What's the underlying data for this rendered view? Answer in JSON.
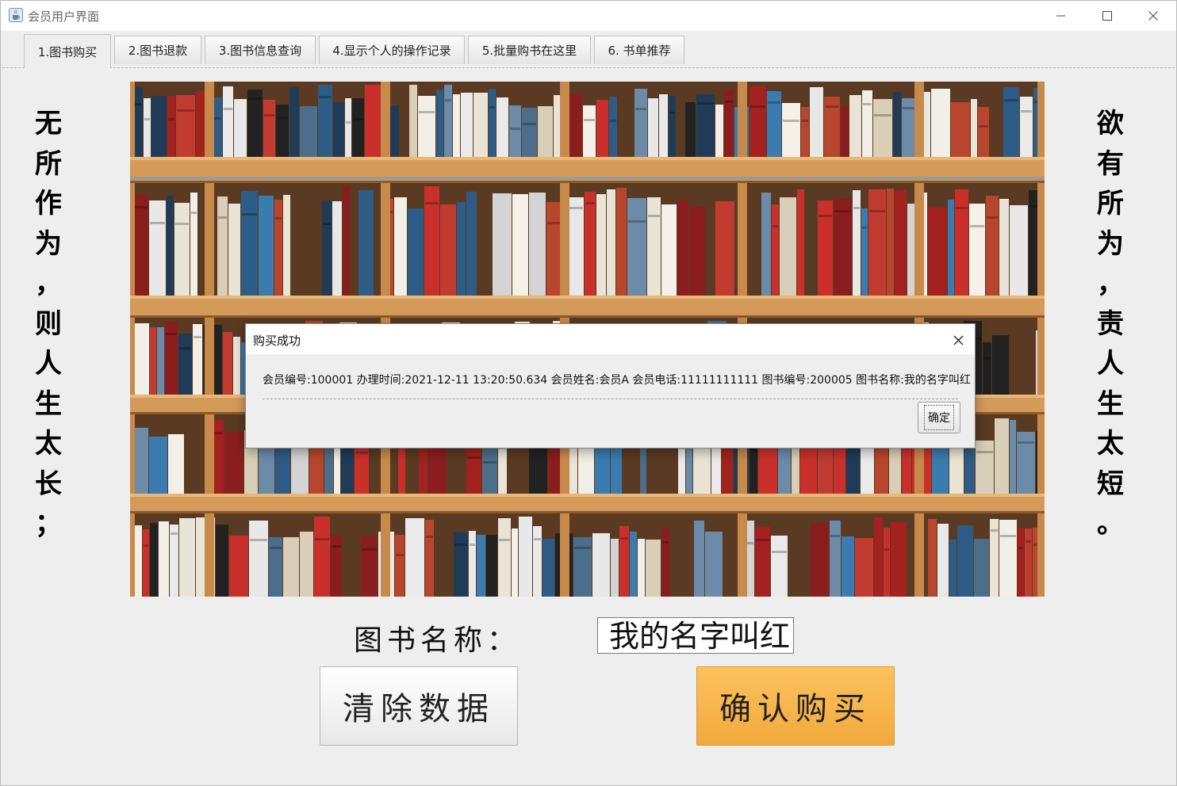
{
  "window": {
    "title": "会员用户界面"
  },
  "tabs": [
    {
      "label": "1.图书购买",
      "active": true
    },
    {
      "label": "2.图书退款",
      "active": false
    },
    {
      "label": "3.图书信息查询",
      "active": false
    },
    {
      "label": "4.显示个人的操作记录",
      "active": false
    },
    {
      "label": "5.批量购书在这里",
      "active": false
    },
    {
      "label": "6. 书单推荐",
      "active": false
    }
  ],
  "side_left": [
    "无",
    "所",
    "作",
    "为",
    "，",
    "则",
    "人",
    "生",
    "太",
    "长",
    "；"
  ],
  "side_right": [
    "欲",
    "有",
    "所",
    "为",
    "，",
    "责",
    "人",
    "生",
    "太",
    "短",
    "。"
  ],
  "form": {
    "book_name_label": "图书名称：",
    "book_name_value": "我的名字叫红",
    "clear_button": "清除数据",
    "buy_button": "确认购买"
  },
  "dialog": {
    "title": "购买成功",
    "message": "会员编号:100001 办理时间:2021-12-11 13:20:50.634 会员姓名:会员A 会员电话:11111111111 图书编号:200005 图书名称:我的名字叫红",
    "ok_button": "确定"
  },
  "colors": {
    "buy_button": "#f5b04a",
    "window_bg": "#eeeeee"
  },
  "icons": {
    "app": "java-cup-icon",
    "minimize": "minimize-icon",
    "maximize": "maximize-icon",
    "close": "close-icon"
  }
}
